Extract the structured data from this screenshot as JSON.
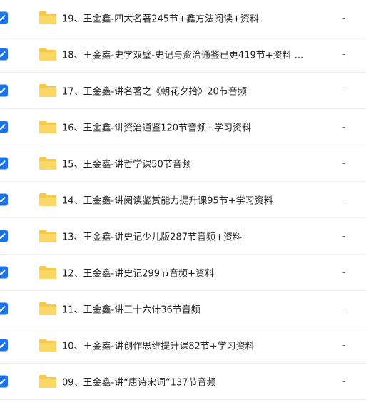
{
  "colors": {
    "accent": "#1a73e8",
    "folder": "#f7c94a"
  },
  "files": [
    {
      "name": "19、王金鑫-四大名著245节+鑫方法阅读+资料",
      "size": "-"
    },
    {
      "name": "18、王金鑫-史学双璧-史记与资治通鉴已更419节+资料 ...",
      "size": "-"
    },
    {
      "name": "17、王金鑫-讲名著之《朝花夕拾》20节音频",
      "size": "-"
    },
    {
      "name": "16、王金鑫-讲资治通鉴120节音频+学习资料",
      "size": "-"
    },
    {
      "name": "15、王金鑫-讲哲学课50节音频",
      "size": "-"
    },
    {
      "name": "14、王金鑫-讲阅读鉴赏能力提升课95节+学习资料",
      "size": "-"
    },
    {
      "name": "13、王金鑫-讲史记少儿版287节音频+资料",
      "size": "-"
    },
    {
      "name": "12、王金鑫-讲史记299节音频+资料",
      "size": "-"
    },
    {
      "name": "11、王金鑫-讲三十六计36节音频",
      "size": "-"
    },
    {
      "name": "10、王金鑫-讲创作思维提升课82节+学习资料",
      "size": "-"
    },
    {
      "name": "09、王金鑫-讲“唐诗宋词”137节音频",
      "size": "-"
    }
  ]
}
